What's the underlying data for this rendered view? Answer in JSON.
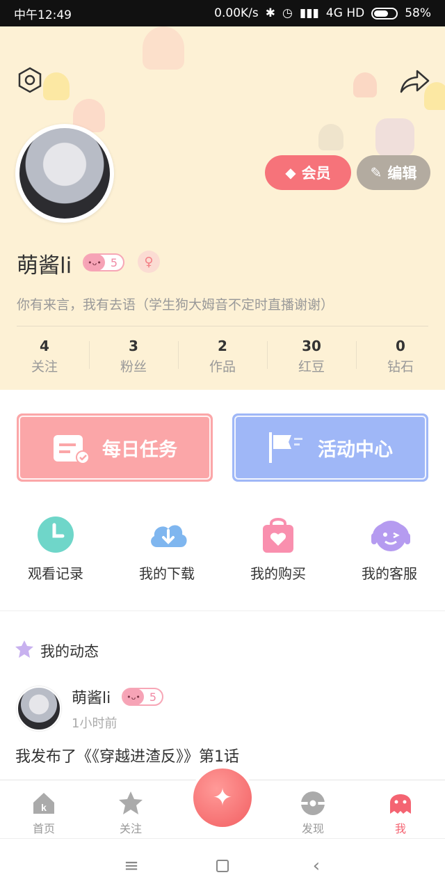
{
  "status_bar": {
    "time": "中午12:49",
    "speed": "0.00K/s",
    "network": "4G HD",
    "battery": "58%"
  },
  "profile": {
    "username": "萌酱li",
    "level": "5",
    "vip_label": "会员",
    "edit_label": "编辑",
    "bio": "你有来言，我有去语（学生狗大姆音不定时直播谢谢）",
    "stats": [
      {
        "value": "4",
        "label": "关注"
      },
      {
        "value": "3",
        "label": "粉丝"
      },
      {
        "value": "2",
        "label": "作品"
      },
      {
        "value": "30",
        "label": "红豆"
      },
      {
        "value": "0",
        "label": "钻石"
      }
    ]
  },
  "cards": {
    "daily": "每日任务",
    "event": "活动中心"
  },
  "quick_actions": [
    {
      "label": "观看记录",
      "icon": "clock-icon"
    },
    {
      "label": "我的下载",
      "icon": "cloud-download-icon"
    },
    {
      "label": "我的购买",
      "icon": "shopping-bag-icon"
    },
    {
      "label": "我的客服",
      "icon": "headset-icon"
    }
  ],
  "feed": {
    "section_title": "我的动态",
    "post": {
      "author": "萌酱li",
      "level": "5",
      "time": "1小时前",
      "text": "我发布了《《穿越进渣反》》第1话"
    }
  },
  "tabbar": [
    {
      "label": "首页",
      "icon": "home-icon"
    },
    {
      "label": "关注",
      "icon": "star-icon"
    },
    {
      "label": "发现",
      "icon": "discover-icon"
    },
    {
      "label": "我",
      "icon": "ghost-icon",
      "active": true
    }
  ],
  "colors": {
    "header_bg": "#fdf1d5",
    "accent": "#f46472",
    "daily_card": "#fba6a8",
    "event_card": "#9fb7f7"
  }
}
